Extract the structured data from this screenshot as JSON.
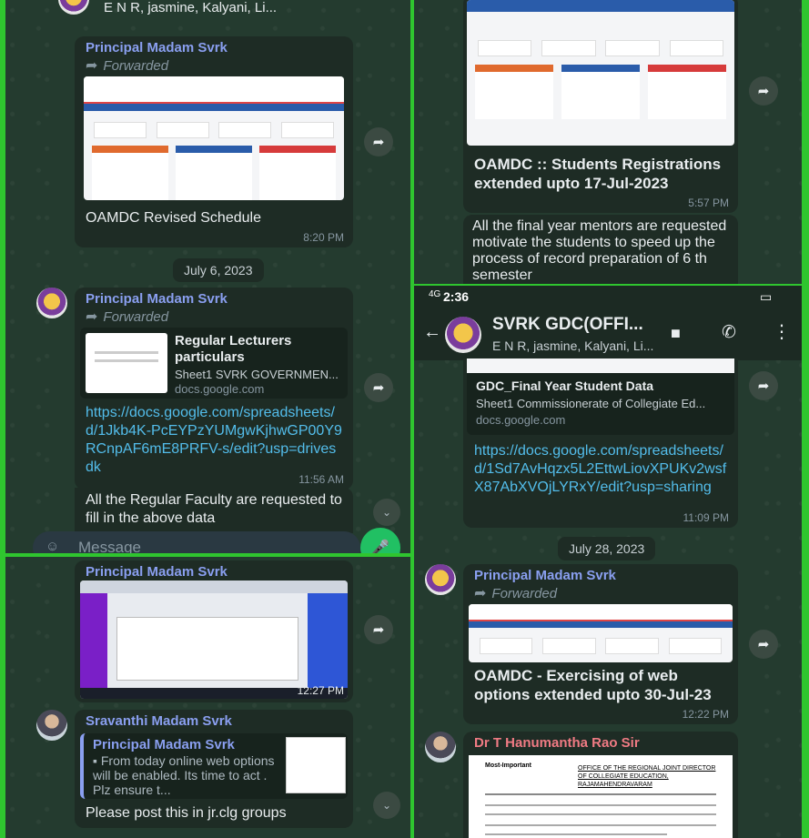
{
  "p1": {
    "top_contacts": "E N R, jasmine, Kalyani, Li...",
    "msg1": {
      "sender": "Principal Madam Svrk",
      "forwarded": "Forwarded",
      "caption": "OAMDC Revised Schedule",
      "time": "8:20 PM"
    },
    "date_chip": "July 6, 2023",
    "msg2": {
      "sender": "Principal Madam Svrk",
      "forwarded": "Forwarded",
      "preview_title": "Regular Lecturers particulars",
      "preview_sub": "Sheet1 SVRK GOVERNMEN...",
      "preview_domain": "docs.google.com",
      "link": "https://docs.google.com/spreadsheets/d/1Jkb4K-PcEYPzYUMgwKjhwGP00Y9RCnpAF6mE8PRFV-s/edit?usp=drivesdk",
      "time": "11:56 AM"
    },
    "msg3_text": "All the Regular Faculty are requested to fill in the above data",
    "message_placeholder": "Message"
  },
  "p2": {
    "msg1": {
      "caption": "OAMDC :: Students Registrations extended upto 17-Jul-2023",
      "time": "5:57 PM"
    },
    "msg2_text": "All the final year mentors are requested motivate the students to speed up the process of record preparation of 6 th semester"
  },
  "p3": {
    "status_time": "2:36",
    "status_signal": "4G",
    "battery": "▭",
    "chat_title": "SVRK GDC(OFFI...",
    "chat_members": "E N R, jasmine, Kalyani, Li...",
    "msg1": {
      "preview_title": "GDC_Final Year Student Data",
      "preview_sub": "Sheet1 Commissionerate of Collegiate Ed...",
      "preview_domain": "docs.google.com",
      "link": "https://docs.google.com/spreadsheets/d/1Sd7AvHqzx5L2EttwLiovXPUKv2wsfX87AbXVOjLYRxY/edit?usp=sharing",
      "time": "11:09 PM"
    },
    "date_chip": "July 28, 2023",
    "msg2": {
      "sender": "Principal Madam Svrk",
      "forwarded": "Forwarded",
      "caption": "OAMDC - Exercising of web options extended upto 30-Jul-23",
      "time": "12:22 PM"
    },
    "msg3": {
      "sender": "Dr T Hanumantha Rao Sir",
      "doc_heading": "OFFICE OF THE REGIONAL JOINT DIRECTOR OF COLLEGIATE EDUCATION, RAJAMAHENDRAVARAM",
      "doc_tag": "Most-Important"
    }
  },
  "p4": {
    "msg1": {
      "sender": "Principal Madam Svrk",
      "time": "12:27 PM"
    },
    "msg2": {
      "sender": "Sravanthi Madam Svrk",
      "quote_sender": "Principal Madam Svrk",
      "quote_text": "From today online web options will be enabled. Its time to act . Plz ensure t...",
      "text": "Please post this in jr.clg groups"
    }
  }
}
